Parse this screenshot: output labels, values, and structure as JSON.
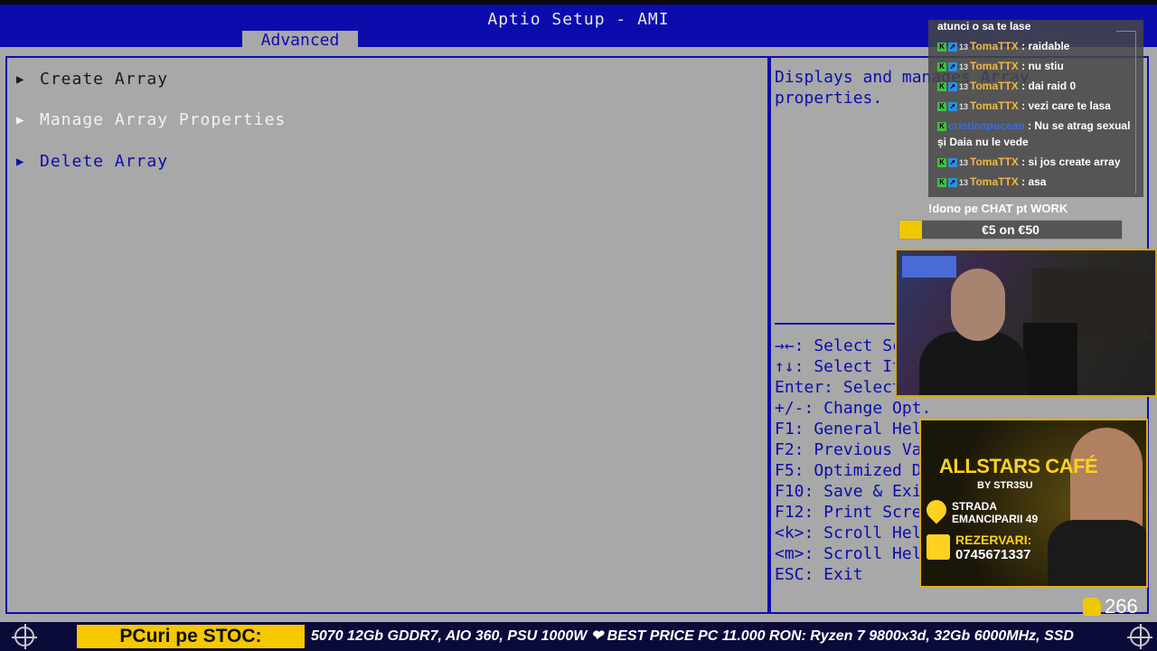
{
  "bios": {
    "title": "Aptio Setup - AMI",
    "active_tab": "Advanced",
    "menu": [
      {
        "label": "Create Array",
        "color": "#1a1a1a"
      },
      {
        "label": "Manage Array Properties",
        "color": "#f2f2f2"
      },
      {
        "label": "Delete Array",
        "color": "#0c0cad"
      }
    ],
    "help_text": "Displays and manages Array\nproperties.",
    "keys": [
      "→←: Select Screen",
      "↑↓: Select Item",
      "Enter: Select",
      "+/-: Change Opt.",
      "F1: General Help",
      "F2: Previous Values",
      "F5: Optimized Defaults",
      "F10: Save & Exit",
      "F12: Print Screen",
      "<k>: Scroll Help Area Upwards",
      "<m>: Scroll Help Area Downwards",
      "ESC: Exit"
    ],
    "colors": {
      "bar": "#0c0cad",
      "body": "#a8a8a8",
      "highlight": "#f2f2f2"
    }
  },
  "chat": {
    "messages": [
      {
        "user": "",
        "text": "atunci o sa te lase"
      },
      {
        "user": "TomaTTX",
        "text": " : raidable"
      },
      {
        "user": "TomaTTX",
        "text": " : nu stiu"
      },
      {
        "user": "TomaTTX",
        "text": " : dai raid 0"
      },
      {
        "user": "TomaTTX",
        "text": " : vezi care te lasa"
      },
      {
        "user": "cristinapucean",
        "text": " : Nu se atrag sexual și Daia nu le vede"
      },
      {
        "user": "TomaTTX",
        "text": " : si jos create array"
      },
      {
        "user": "TomaTTX",
        "text": " : asa"
      }
    ]
  },
  "donation": {
    "title": "!dono pe CHAT pt WORK",
    "progress_text": "€5 on €50",
    "progress_fraction": 0.1
  },
  "promo": {
    "title": "ALLSTARS CAFÉ",
    "subtitle": "BY STR3SU",
    "address": "STRADA\nEMANCIPARII 49",
    "reservations_label": "REZERVARI:",
    "phone": "0745671337"
  },
  "likes": {
    "count": "266"
  },
  "ticker": {
    "label": "PCuri pe STOC:",
    "text": "5070 12Gb GDDR7, AIO 360, PSU 1000W ❤ BEST PRICE PC 11.000 RON: Ryzen 7 9800x3d, 32Gb 6000MHz, SSD"
  }
}
